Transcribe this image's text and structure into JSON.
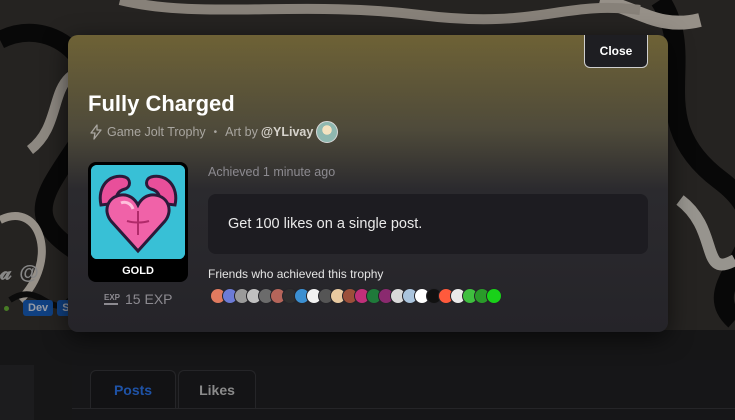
{
  "background_page": {
    "handle_fragment": "@",
    "badges": [
      "Dev",
      "S"
    ],
    "tabs": [
      {
        "label": "Posts",
        "active": true
      },
      {
        "label": "Likes",
        "active": false
      }
    ]
  },
  "modal": {
    "close_label": "Close",
    "title": "Fully Charged",
    "subtitle": {
      "icon": "bolt-icon",
      "type": "Game Jolt Trophy",
      "separator": "•",
      "art_by_label": "Art by",
      "artist": "@YLivay"
    },
    "trophy": {
      "image": "flexing-heart-muscle-pixel-art",
      "tier": "GOLD",
      "exp": "15 EXP",
      "exp_icon_text": "EXP"
    },
    "achieved_text": "Achieved 1 minute ago",
    "description": "Get 100 likes on a single post.",
    "friends_label": "Friends who achieved this trophy",
    "friend_avatar_colors": [
      "#e07a5f",
      "#6c7bd6",
      "#9a9a9a",
      "#c0c0c0",
      "#6b6b6b",
      "#b5655a",
      "#2f2f2f",
      "#3b8fd1",
      "#f2f2f2",
      "#555",
      "#e8c9a0",
      "#9c4f3a",
      "#c0307a",
      "#1f7a3a",
      "#8a2a6f",
      "#d9d9d9",
      "#aac4dd",
      "#ffffff",
      "#111",
      "#ff5a3c",
      "#e9e9e9",
      "#3fbf3f",
      "#2a9a2a",
      "#19d119"
    ],
    "colors": {
      "accent_gold": "#6e6236",
      "link_blue": "#2f7fff",
      "trophy_bg": "#38c0d6"
    }
  }
}
